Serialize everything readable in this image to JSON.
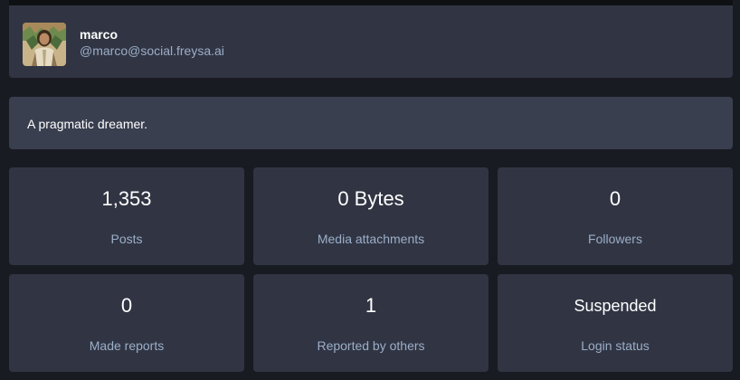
{
  "account": {
    "display_name": "marco",
    "handle": "@marco@social.freysa.ai",
    "avatar_icon": "avatar-image"
  },
  "bio": {
    "text": "A pragmatic dreamer."
  },
  "stats": [
    {
      "value": "1,353",
      "label": "Posts"
    },
    {
      "value": "0 Bytes",
      "label": "Media attachments"
    },
    {
      "value": "0",
      "label": "Followers"
    },
    {
      "value": "0",
      "label": "Made reports"
    },
    {
      "value": "1",
      "label": "Reported by others"
    },
    {
      "value": "Suspended",
      "label": "Login status"
    }
  ],
  "colors": {
    "background": "#191b22",
    "card": "#313543",
    "bio_card": "#393f4f",
    "muted_text": "#9baec8"
  }
}
